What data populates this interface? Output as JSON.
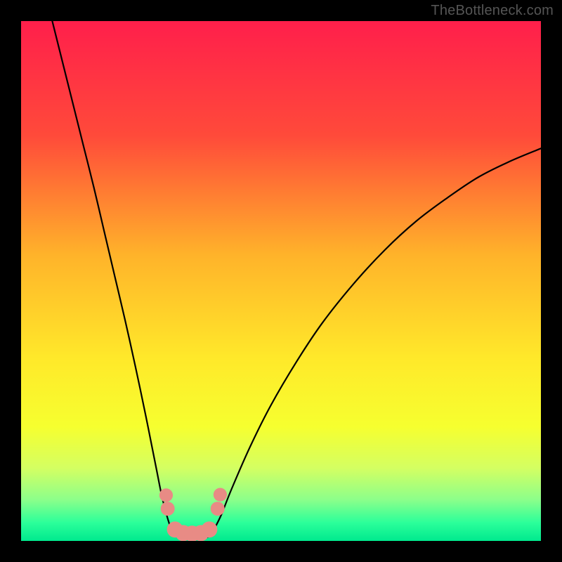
{
  "watermark": "TheBottleneck.com",
  "chart_data": {
    "type": "line",
    "title": "",
    "xlabel": "",
    "ylabel": "",
    "xlim": [
      0,
      100
    ],
    "ylim": [
      0,
      100
    ],
    "background_gradient": {
      "stops": [
        {
          "offset": 0.0,
          "color": "#ff1f4b"
        },
        {
          "offset": 0.22,
          "color": "#ff4a3a"
        },
        {
          "offset": 0.45,
          "color": "#ffb32a"
        },
        {
          "offset": 0.65,
          "color": "#ffe92a"
        },
        {
          "offset": 0.78,
          "color": "#f6ff2f"
        },
        {
          "offset": 0.86,
          "color": "#d4ff62"
        },
        {
          "offset": 0.92,
          "color": "#8dff8a"
        },
        {
          "offset": 0.965,
          "color": "#2bff9a"
        },
        {
          "offset": 1.0,
          "color": "#00e98e"
        }
      ]
    },
    "series": [
      {
        "name": "left-branch",
        "stroke": "#000000",
        "stroke_width": 2.2,
        "points": [
          {
            "x": 6.0,
            "y": 100.0
          },
          {
            "x": 8.0,
            "y": 92.0
          },
          {
            "x": 10.0,
            "y": 84.0
          },
          {
            "x": 12.0,
            "y": 76.0
          },
          {
            "x": 14.0,
            "y": 68.0
          },
          {
            "x": 16.0,
            "y": 59.5
          },
          {
            "x": 18.0,
            "y": 51.0
          },
          {
            "x": 20.0,
            "y": 42.5
          },
          {
            "x": 22.0,
            "y": 33.5
          },
          {
            "x": 24.0,
            "y": 24.0
          },
          {
            "x": 26.0,
            "y": 14.0
          },
          {
            "x": 27.0,
            "y": 9.0
          },
          {
            "x": 28.0,
            "y": 5.0
          },
          {
            "x": 29.0,
            "y": 2.0
          },
          {
            "x": 30.0,
            "y": 0.8
          },
          {
            "x": 31.5,
            "y": 0.4
          },
          {
            "x": 33.0,
            "y": 0.2
          },
          {
            "x": 34.5,
            "y": 0.4
          },
          {
            "x": 36.0,
            "y": 0.8
          },
          {
            "x": 37.0,
            "y": 2.0
          }
        ]
      },
      {
        "name": "right-branch",
        "stroke": "#000000",
        "stroke_width": 2.2,
        "points": [
          {
            "x": 37.0,
            "y": 2.0
          },
          {
            "x": 38.5,
            "y": 5.0
          },
          {
            "x": 40.5,
            "y": 10.0
          },
          {
            "x": 44.0,
            "y": 18.0
          },
          {
            "x": 48.0,
            "y": 26.0
          },
          {
            "x": 53.0,
            "y": 34.5
          },
          {
            "x": 58.0,
            "y": 42.0
          },
          {
            "x": 64.0,
            "y": 49.5
          },
          {
            "x": 70.0,
            "y": 56.0
          },
          {
            "x": 76.0,
            "y": 61.5
          },
          {
            "x": 82.0,
            "y": 66.0
          },
          {
            "x": 88.0,
            "y": 70.0
          },
          {
            "x": 94.0,
            "y": 73.0
          },
          {
            "x": 100.0,
            "y": 75.5
          }
        ]
      }
    ],
    "markers": [
      {
        "x": 27.9,
        "y": 8.8,
        "r": 1.3,
        "fill": "#e88b85"
      },
      {
        "x": 28.2,
        "y": 6.2,
        "r": 1.35,
        "fill": "#e88b85"
      },
      {
        "x": 29.6,
        "y": 2.2,
        "r": 1.55,
        "fill": "#e88b85"
      },
      {
        "x": 31.2,
        "y": 1.5,
        "r": 1.55,
        "fill": "#e88b85"
      },
      {
        "x": 32.9,
        "y": 1.4,
        "r": 1.55,
        "fill": "#e88b85"
      },
      {
        "x": 34.6,
        "y": 1.5,
        "r": 1.55,
        "fill": "#e88b85"
      },
      {
        "x": 36.2,
        "y": 2.2,
        "r": 1.55,
        "fill": "#e88b85"
      },
      {
        "x": 37.8,
        "y": 6.2,
        "r": 1.35,
        "fill": "#e88b85"
      },
      {
        "x": 38.3,
        "y": 8.9,
        "r": 1.3,
        "fill": "#e88b85"
      }
    ]
  }
}
